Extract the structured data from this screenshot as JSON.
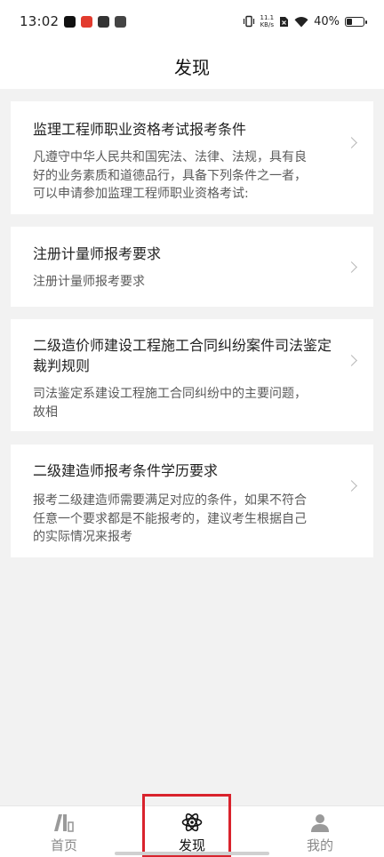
{
  "status_bar": {
    "time": "13:02",
    "net_speed_value": "11.1",
    "net_speed_unit": "KB/s",
    "battery": "40%"
  },
  "header": {
    "title": "发现"
  },
  "articles": [
    {
      "title": "监理工程师职业资格考试报考条件",
      "desc_lines": [
        "凡遵守中华人民共和国宪法、法律、法规，具有良",
        "好的业务素质和道德品行，具备下列条件之一者，",
        "可以申请参加监理工程师职业资格考试:"
      ]
    },
    {
      "title": "注册计量师报考要求",
      "desc_lines": [
        "注册计量师报考要求"
      ]
    },
    {
      "title_lines": [
        "二级造价师建设工程施工合同纠纷案件司法鉴定",
        "裁判规则"
      ],
      "desc_lines": [
        "司法鉴定系建设工程施工合同纠纷中的主要问题，",
        "故相"
      ]
    },
    {
      "title": "二级建造师报考条件学历要求",
      "desc_lines": [
        "报考二级建造师需要满足对应的条件，如果不符合",
        "任意一个要求都是不能报考的，建议考生根据自己",
        "的实际情况来报考"
      ]
    }
  ],
  "tab_bar": {
    "tabs": [
      {
        "label": "首页",
        "icon": "books-icon"
      },
      {
        "label": "发现",
        "icon": "atom-icon",
        "active": true
      },
      {
        "label": "我的",
        "icon": "person-icon"
      }
    ]
  },
  "colors": {
    "accent_highlight": "#d9232d",
    "background": "#f2f2f2"
  }
}
